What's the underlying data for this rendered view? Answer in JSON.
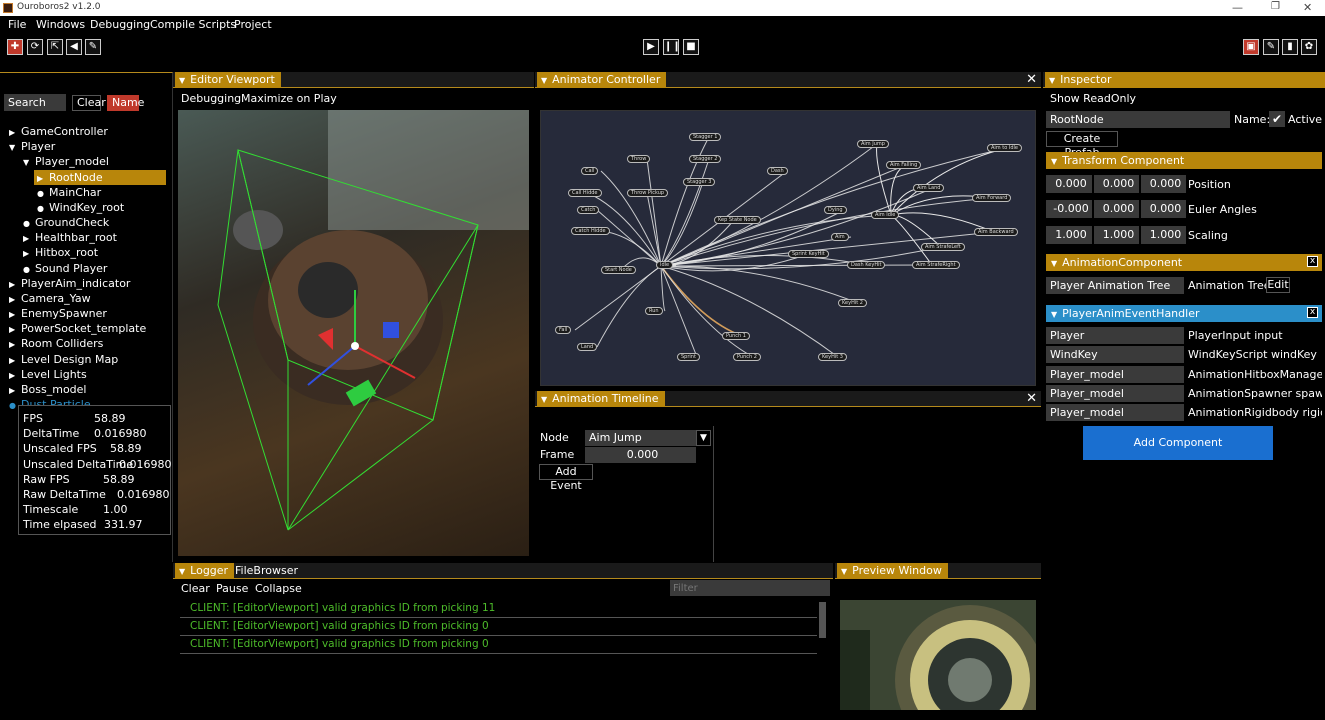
{
  "window": {
    "title": "Ouroboros2 v1.2.0"
  },
  "menu": {
    "items": [
      "File",
      "Windows",
      "Debugging",
      "Compile Scripts",
      "Project"
    ]
  },
  "hierarchy": {
    "search_label": "Search",
    "clear_label": "Clear",
    "name_label": "Name",
    "items": [
      "GameController",
      "Player",
      "Player_model",
      "RootNode",
      "MainChar",
      "WindKey_root",
      "GroundCheck",
      "Healthbar_root",
      "Hitbox_root",
      "Sound Player",
      "PlayerAim_indicator",
      "Camera_Yaw",
      "EnemySpawner",
      "PowerSocket_template",
      "Room Colliders",
      "Level Design Map",
      "Level Lights",
      "Boss_model",
      "Dust Particle"
    ]
  },
  "stats": {
    "labels": [
      "FPS",
      "DeltaTime",
      "Unscaled FPS",
      "Unscaled DeltaTime",
      "Raw FPS",
      "Raw DeltaTime",
      "Timescale",
      "Time elpased"
    ],
    "values": [
      "58.89",
      "0.016980",
      "58.89",
      "0.016980",
      "58.89",
      "0.016980",
      "1.00",
      "331.97"
    ]
  },
  "viewport": {
    "tab": "Editor Viewport",
    "debugging": "Debugging",
    "maximize": "Maximize on Play"
  },
  "animator": {
    "tab": "Animator Controller",
    "nodes": [
      "Stagger 1",
      "Throw",
      "Stagger 2",
      "Call",
      "Dash",
      "Aim Jump",
      "Aim to Idle",
      "Aim Falling",
      "Stagger 3",
      "Call Hidde",
      "Throw Pickup",
      "Aim Land",
      "Aim Forward",
      "Catch",
      "Dying",
      "Aim Idle",
      "Aim Backward",
      "Kep State Node",
      "Catch Hidde",
      "Aim",
      "Aim StrafeLeft",
      "Start Node",
      "Idle",
      "Sprint KeyHit",
      "Dash KeyHit",
      "Aim StrafeRight",
      "Run",
      "KeyHit 2",
      "Fall",
      "Punch 1",
      "Land",
      "Sprint",
      "Punch 2",
      "KeyHit 3"
    ]
  },
  "timeline": {
    "tab": "Animation Timeline",
    "node_label": "Node",
    "node_value": "Aim Jump",
    "frame_label": "Frame",
    "frame_value": "0.000",
    "add_event": "Add Event"
  },
  "inspector": {
    "tab": "Inspector",
    "show_readonly": "Show ReadOnly",
    "node_name": "RootNode",
    "name_label": "Name:",
    "active_label": "Active",
    "create_prefab": "Create Prefab",
    "transform": {
      "header": "Transform Component",
      "position": [
        "0.000",
        "0.000",
        "0.000"
      ],
      "position_label": "Position",
      "euler": [
        "-0.000",
        "0.000",
        "0.000"
      ],
      "euler_label": "Euler Angles",
      "scale": [
        "1.000",
        "1.000",
        "1.000"
      ],
      "scale_label": "Scaling"
    },
    "animation": {
      "header": "AnimationComponent",
      "field": "Player Animation Tree",
      "label": "Animation Tree",
      "edit": "Edit"
    },
    "handler": {
      "header": "PlayerAnimEventHandler",
      "rows": [
        {
          "name": "Player",
          "value": "PlayerInput input"
        },
        {
          "name": "WindKey",
          "value": "WindKeyScript windKey"
        },
        {
          "name": "Player_model",
          "value": "AnimationHitboxManager hit"
        },
        {
          "name": "Player_model",
          "value": "AnimationSpawner spawner"
        },
        {
          "name": "Player_model",
          "value": "AnimationRigidbody rigidbod"
        }
      ]
    },
    "add_component": "Add Component"
  },
  "logger": {
    "tab": "Logger",
    "tab2": "FileBrowser",
    "clear": "Clear",
    "pause": "Pause",
    "collapse": "Collapse",
    "filter_placeholder": "Filter",
    "lines": [
      "CLIENT: [EditorViewport] valid graphics ID from picking 11",
      "CLIENT: [EditorViewport] valid graphics ID from picking 0",
      "CLIENT: [EditorViewport] valid graphics ID from picking 0"
    ]
  },
  "preview": {
    "tab": "Preview Window"
  },
  "colors": {
    "accent": "#b8860b",
    "blue": "#2b8fc9",
    "log_green": "#4dbb2a",
    "button_blue": "#1a6fd0"
  }
}
